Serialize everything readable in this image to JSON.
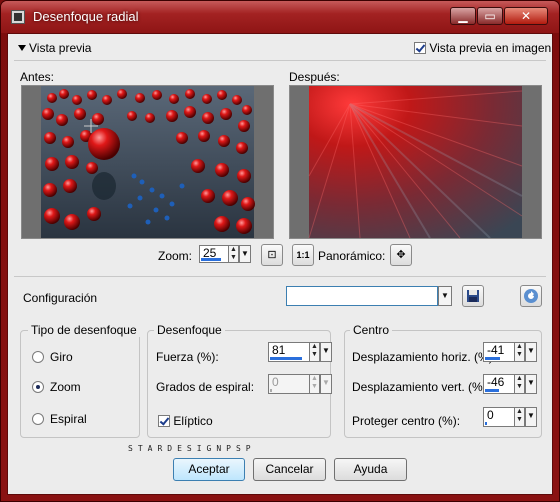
{
  "window": {
    "title": "Desenfoque radial",
    "controls": [
      "▁",
      "▭",
      "✕"
    ]
  },
  "preview": {
    "toggle_label": "Vista previa",
    "image_preview_label": "Vista previa en imagen",
    "image_preview_checked": true,
    "before_label": "Antes:",
    "after_label": "Después:",
    "zoom_label": "Zoom:",
    "zoom_value": "25",
    "pan_label": "Panorámico:",
    "one_to_one": "1:1"
  },
  "config": {
    "label": "Configuración",
    "preset_value": ""
  },
  "blur_type": {
    "title": "Tipo de desenfoque",
    "options": [
      "Giro",
      "Zoom",
      "Espiral"
    ],
    "selected": "Zoom"
  },
  "blur": {
    "title": "Desenfoque",
    "strength_label": "Fuerza (%):",
    "strength_value": "81",
    "spiral_label": "Grados de espiral:",
    "spiral_value": "0",
    "elliptic_label": "Elíptico",
    "elliptic_checked": true
  },
  "center": {
    "title": "Centro",
    "h_offset_label": "Desplazamiento horiz. (%):",
    "h_offset_value": "-41",
    "v_offset_label": "Desplazamiento vert. (%):",
    "v_offset_value": "-46",
    "protect_label": "Proteger centro (%):",
    "protect_value": "0"
  },
  "watermark": "STARDESIGNPSP",
  "buttons": {
    "ok": "Aceptar",
    "cancel": "Cancelar",
    "help": "Ayuda"
  },
  "colors": {
    "title_red": "#8e1515",
    "accent_blue": "#2a6fdc",
    "sphere_red": "#d01010"
  }
}
